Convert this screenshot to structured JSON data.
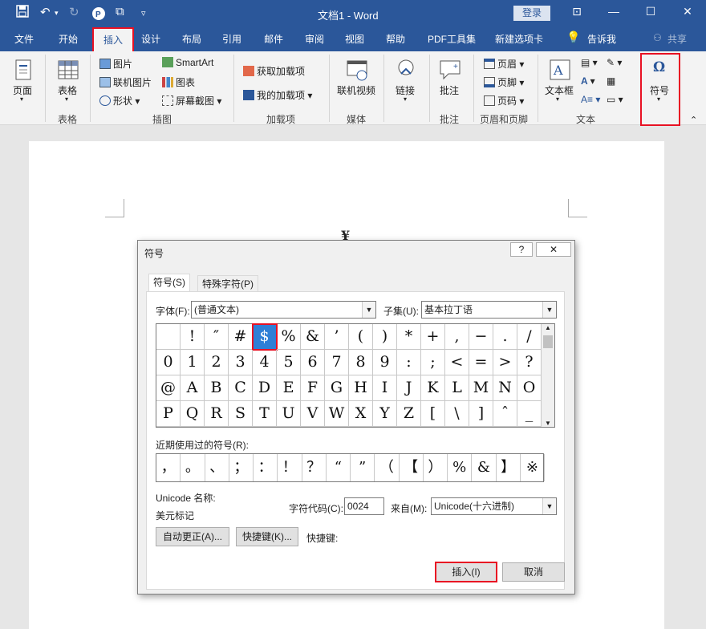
{
  "titlebar": {
    "doc_title": "文档1 - Word",
    "login": "登录"
  },
  "tabs": [
    "文件",
    "开始",
    "插入",
    "设计",
    "布局",
    "引用",
    "邮件",
    "审阅",
    "视图",
    "帮助",
    "PDF工具集",
    "新建选项卡"
  ],
  "tellme": "告诉我",
  "share": "共享",
  "ribbon": {
    "pages": "页面",
    "table": "表格",
    "group_table": "表格",
    "picture": "图片",
    "online_picture": "联机图片",
    "shapes": "形状",
    "smartart": "SmartArt",
    "chart": "图表",
    "screenshot": "屏幕截图",
    "group_illustrations": "插图",
    "get_addins": "获取加载项",
    "my_addins": "我的加载项",
    "group_addins": "加载项",
    "online_video": "联机视频",
    "group_media": "媒体",
    "link": "链接",
    "comment": "批注",
    "group_comment": "批注",
    "header": "页眉",
    "footer": "页脚",
    "page_number": "页码",
    "group_header_footer": "页眉和页脚",
    "textbox": "文本框",
    "group_text": "文本",
    "symbol": "符号"
  },
  "document": {
    "yen": "¥"
  },
  "dialog": {
    "title": "符号",
    "help": "?",
    "tab_symbols": "符号(S)",
    "tab_special": "特殊字符(P)",
    "font_label": "字体(F):",
    "font_value": "(普通文本)",
    "subset_label": "子集(U):",
    "subset_value": "基本拉丁语",
    "grid": [
      [
        "",
        "!",
        "″",
        "#",
        "$",
        "%",
        "&",
        "’",
        "(",
        ")",
        "*",
        "+",
        ",",
        "−",
        ".",
        "/"
      ],
      [
        "0",
        "1",
        "2",
        "3",
        "4",
        "5",
        "6",
        "7",
        "8",
        "9",
        ":",
        ";",
        "<",
        "=",
        ">",
        "?"
      ],
      [
        "@",
        "A",
        "B",
        "C",
        "D",
        "E",
        "F",
        "G",
        "H",
        "I",
        "J",
        "K",
        "L",
        "M",
        "N",
        "O"
      ],
      [
        "P",
        "Q",
        "R",
        "S",
        "T",
        "U",
        "V",
        "W",
        "X",
        "Y",
        "Z",
        "[",
        "\\",
        "]",
        "ˆ",
        "_"
      ]
    ],
    "recent_label": "近期使用过的符号(R):",
    "recent": [
      "，",
      "。",
      "、",
      "；",
      "：",
      "！",
      "？",
      "“",
      "”",
      "（",
      "【",
      "）",
      "%",
      "&",
      "】",
      "※"
    ],
    "unicode_name_label": "Unicode 名称:",
    "unicode_name_value": "美元标记",
    "char_code_label": "字符代码(C):",
    "char_code_value": "0024",
    "from_label": "来自(M):",
    "from_value": "Unicode(十六进制)",
    "autocorrect_btn": "自动更正(A)...",
    "shortcut_btn": "快捷键(K)...",
    "shortcut_label": "快捷键:",
    "insert_btn": "插入(I)",
    "cancel_btn": "取消"
  },
  "colors": {
    "accent": "#2b579a",
    "highlight": "#e81123",
    "selection": "#2f7fd6"
  }
}
